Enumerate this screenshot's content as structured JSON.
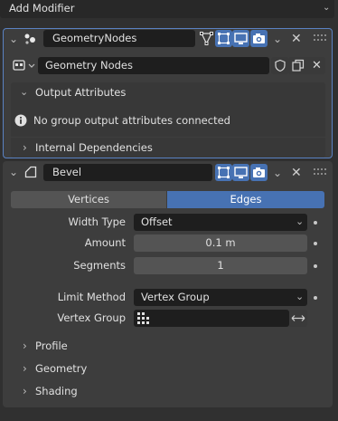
{
  "add_modifier": {
    "label": "Add Modifier"
  },
  "geometry_nodes": {
    "name": "GeometryNodes",
    "node_group": "Geometry Nodes",
    "output_attributes_label": "Output Attributes",
    "no_attrs_message": "No group output attributes connected",
    "internal_dependencies_label": "Internal Dependencies"
  },
  "bevel": {
    "name": "Bevel",
    "tabs": [
      "Vertices",
      "Edges"
    ],
    "active_tab": "Edges",
    "width_type_label": "Width Type",
    "width_type_value": "Offset",
    "amount_label": "Amount",
    "amount_value": "0.1 m",
    "segments_label": "Segments",
    "segments_value": "1",
    "limit_method_label": "Limit Method",
    "limit_method_value": "Vertex Group",
    "vertex_group_label": "Vertex Group",
    "vertex_group_value": "",
    "subpanels": [
      "Profile",
      "Geometry",
      "Shading"
    ]
  },
  "colors": {
    "active_blue": "#4772b3",
    "selected_outline": "#5a82c3"
  }
}
